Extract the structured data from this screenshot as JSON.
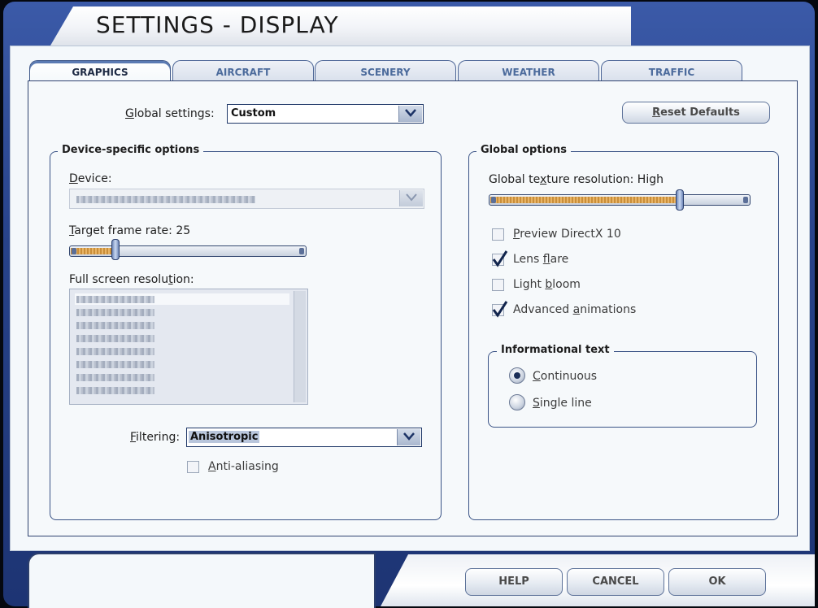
{
  "window": {
    "title": "SETTINGS - DISPLAY"
  },
  "tabs": [
    {
      "label": "GRAPHICS",
      "active": true
    },
    {
      "label": "AIRCRAFT",
      "active": false
    },
    {
      "label": "SCENERY",
      "active": false
    },
    {
      "label": "WEATHER",
      "active": false
    },
    {
      "label": "TRAFFIC",
      "active": false
    }
  ],
  "global_settings": {
    "label_accel": "G",
    "label_rest": "lobal settings:",
    "value": "Custom"
  },
  "reset_button": {
    "accel": "R",
    "rest": "eset Defaults"
  },
  "device_options": {
    "legend": "Device-specific options",
    "device_label_accel": "D",
    "device_label_rest": "evice:",
    "target_label_accel": "T",
    "target_label_rest": "arget frame rate: 25",
    "target_level": 0.18,
    "resolution_label_pre": "Full screen resolu",
    "resolution_label_accel": "t",
    "resolution_label_post": "ion:",
    "filtering_label_accel": "F",
    "filtering_label_rest": "iltering:",
    "filtering_value": "Anisotropic",
    "anti_aliasing_accel": "A",
    "anti_aliasing_rest": "nti-aliasing",
    "anti_aliasing_checked": false
  },
  "global_options": {
    "legend": "Global options",
    "texture_label_pre": "Global te",
    "texture_label_accel": "x",
    "texture_label_post": "ture resolution: High",
    "texture_level": 0.74,
    "checkboxes": [
      {
        "accel": "P",
        "rest": "review DirectX 10",
        "checked": false
      },
      {
        "pre": "Lens ",
        "accel": "f",
        "rest": "lare",
        "checked": true
      },
      {
        "pre": "Light ",
        "accel": "b",
        "rest": "loom",
        "checked": false
      },
      {
        "pre": "Advanced ",
        "accel": "a",
        "rest": "nimations",
        "checked": true
      }
    ]
  },
  "informational_text": {
    "legend": "Informational text",
    "options": [
      {
        "accel": "C",
        "rest": "ontinuous",
        "selected": true
      },
      {
        "accel": "S",
        "rest": "ingle line",
        "selected": false
      }
    ]
  },
  "footer": {
    "help": "HELP",
    "cancel": "CANCEL",
    "ok": "OK"
  },
  "icons": {
    "dropdown_arrow": "chevron-down-icon",
    "checkmark": "checkmark-icon"
  },
  "colors": {
    "frame": "#27428a",
    "panel_border": "#2f4370",
    "slider_fill": "#c98e3a"
  }
}
